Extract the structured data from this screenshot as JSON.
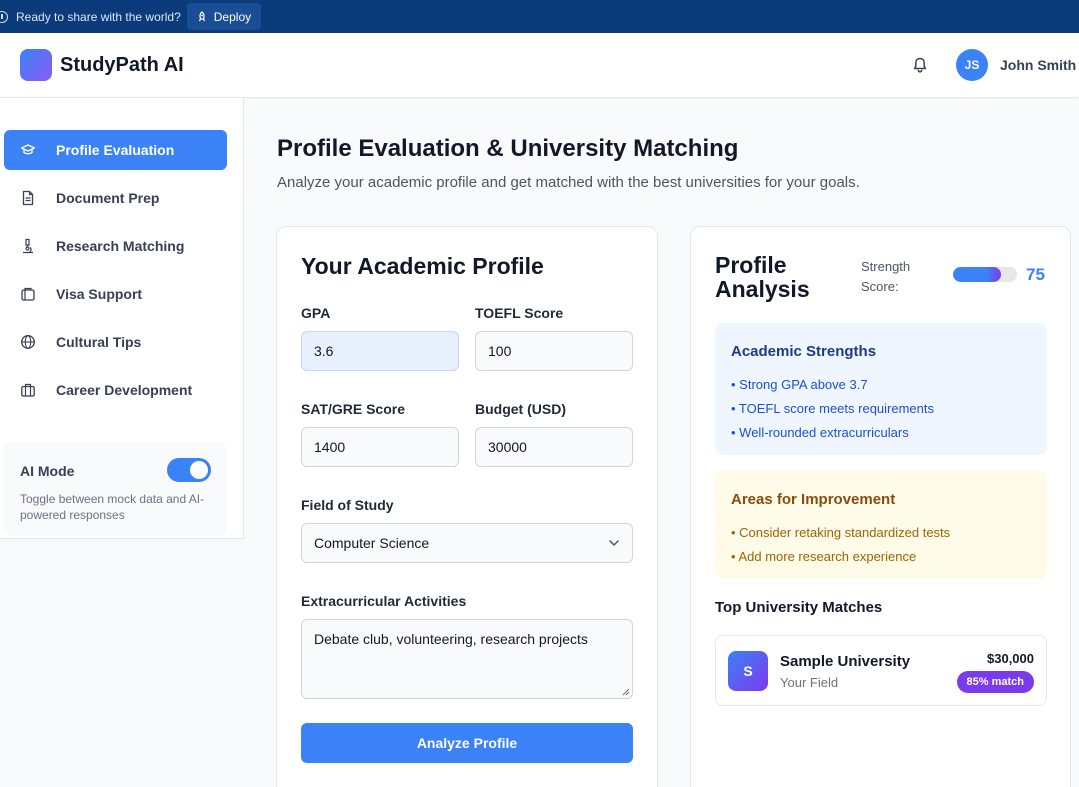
{
  "topbar": {
    "message": "Ready to share with the world?",
    "deploy_label": "Deploy"
  },
  "header": {
    "app_name": "StudyPath AI",
    "user_initials": "JS",
    "user_name": "John Smith"
  },
  "sidebar": {
    "items": [
      {
        "label": "Profile Evaluation",
        "icon": "graduation-cap-icon",
        "active": true
      },
      {
        "label": "Document Prep",
        "icon": "document-icon",
        "active": false
      },
      {
        "label": "Research Matching",
        "icon": "microscope-icon",
        "active": false
      },
      {
        "label": "Visa Support",
        "icon": "passport-icon",
        "active": false
      },
      {
        "label": "Cultural Tips",
        "icon": "globe-icon",
        "active": false
      },
      {
        "label": "Career Development",
        "icon": "briefcase-icon",
        "active": false
      }
    ],
    "ai_mode": {
      "title": "AI Mode",
      "enabled": true,
      "description": "Toggle between mock data and AI-powered responses"
    }
  },
  "page": {
    "title": "Profile Evaluation & University Matching",
    "subtitle": "Analyze your academic profile and get matched with the best universities for your goals."
  },
  "form": {
    "title": "Your Academic Profile",
    "gpa_label": "GPA",
    "gpa_value": "3.6",
    "toefl_label": "TOEFL Score",
    "toefl_value": "100",
    "sat_label": "SAT/GRE Score",
    "sat_value": "1400",
    "budget_label": "Budget (USD)",
    "budget_value": "30000",
    "field_label": "Field of Study",
    "field_value": "Computer Science",
    "extra_label": "Extracurricular Activities",
    "extra_value": "Debate club, volunteering, research projects",
    "submit_label": "Analyze Profile"
  },
  "analysis": {
    "title": "Profile Analysis",
    "strength_label": "Strength Score:",
    "strength_value": "75",
    "strength_fraction": 0.75,
    "strengths_title": "Academic Strengths",
    "strengths": [
      "• Strong GPA above 3.7",
      "• TOEFL score meets requirements",
      "• Well-rounded extracurriculars"
    ],
    "improvement_title": "Areas for Improvement",
    "improvements": [
      "• Consider retaking standardized tests",
      "• Add more research experience"
    ],
    "matches_title": "Top University Matches",
    "matches": [
      {
        "initial": "S",
        "name": "Sample University",
        "field": "Your Field",
        "cost": "$30,000",
        "match": "85% match"
      }
    ]
  },
  "colors": {
    "primary": "#3b82f6",
    "accent_purple": "#7c3aed",
    "topbar": "#0b3b7a"
  }
}
